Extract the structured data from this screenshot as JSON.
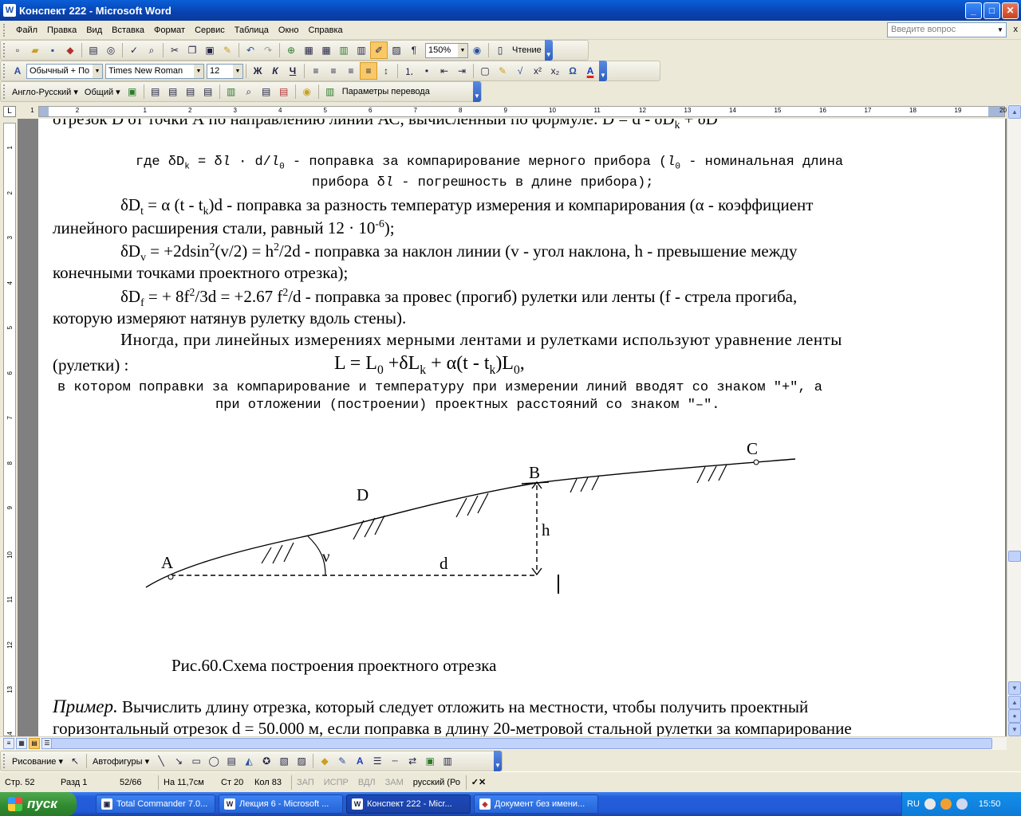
{
  "window": {
    "title": "Конспект  222 - Microsoft Word",
    "app_icon": "W",
    "buttons": [
      "_",
      "□",
      "✕"
    ]
  },
  "menu": {
    "items": [
      "Файл",
      "Правка",
      "Вид",
      "Вставка",
      "Формат",
      "Сервис",
      "Таблица",
      "Окно",
      "Справка"
    ],
    "help_placeholder": "Введите вопрос",
    "close": "x"
  },
  "toolbar_standard": {
    "zoom": "150%",
    "reading": "Чтение"
  },
  "toolbar_format": {
    "style": "Обычный + По ц",
    "font": "Times New Roman",
    "size": "12",
    "bold": "Ж",
    "italic": "К",
    "underline": "Ч",
    "omega": "Ω"
  },
  "toolbar_translate": {
    "lang": "Англо-Русский",
    "dict": "Общий",
    "params": "Параметры перевода"
  },
  "ruler": {
    "h_numbers": [
      "1",
      "2",
      "1",
      "2",
      "3",
      "4",
      "5",
      "6",
      "7",
      "8",
      "9",
      "10",
      "11",
      "12",
      "13",
      "14",
      "15",
      "16",
      "17",
      "18",
      "19",
      "20"
    ],
    "v_numbers": [
      "1",
      "2",
      "3",
      "4",
      "5",
      "6",
      "7",
      "8",
      "9",
      "10",
      "11",
      "12",
      "13",
      "14",
      "15"
    ]
  },
  "document": {
    "line0": "отрезок D от точки А по направлению линии АС, вычисленный по формуле:  D = d - δD",
    "line0_sub": "k",
    "line0_tail": " + δD",
    "mono1": "где δD",
    "mono1_sub": "k",
    "mono1_mid": " = δ",
    "mono1_l": "l",
    "mono1_rest": " · d/",
    "mono1_l2": "l",
    "mono1_sub0": "0",
    "mono1_tail": " - поправка за компарирование мерного прибора (",
    "mono1_l3": "l",
    "mono1_sub0b": "0",
    "mono1_tail2": " - номинальная длина",
    "mono2_pre": "прибора δ",
    "mono2_l": "l",
    "mono2_tail": " - погрешность в длине прибора);",
    "p_t_a": "δD",
    "p_t_sub": "t",
    "p_t_b": " =  α (t - t",
    "p_t_sub2": "k",
    "p_t_c": ")d - поправка за разность температур измерения и компарирования (α -  коэффициент",
    "p_t2": "линейного  расширения  стали, равный 12 · 10",
    "p_t2_sup": "-6",
    "p_t2_tail": ");",
    "p_v_a": "δD",
    "p_v_sub": "v",
    "p_v_b": " = +2dsin",
    "p_v_sup": "2",
    "p_v_c": "(v/2)  =  h",
    "p_v_sup2": "2",
    "p_v_d": "/2d - поправка за наклон линии (v - угол наклона, h - превышение между",
    "p_v2": "конечными точками проектного отрезка);",
    "p_f_a": "δD",
    "p_f_sub": "f",
    "p_f_b": " = + 8f",
    "p_f_sup": "2",
    "p_f_c": "/3d = +2.67  f",
    "p_f_sup2": "2",
    "p_f_d": "/d - поправка за провес (прогиб) рулетки или ленты (f - стрела прогиба,",
    "p_f2": "которую измеряют натянув рулетку вдоль стены).",
    "p_i1": "Иногда, при линейных измерениях мерными лентами и рулетками используют уравнение ленты",
    "p_i2": "(рулетки) :",
    "formula_a": "L = L",
    "formula_sub0": "0",
    "formula_b": " +δL",
    "formula_subk": "k",
    "formula_c": " + α(t - t",
    "formula_subk2": "k",
    "formula_d": ")L",
    "formula_sub0b": "0",
    "formula_e": ",",
    "mono3": "в котором  поправки за компарирование и температуру при измерении линий вводят со знаком \"+\", а",
    "mono4": "при отложении (построении) проектных расстояний со знаком \"–\".",
    "fig_labels": {
      "A": "A",
      "B": "B",
      "C": "C",
      "D": "D",
      "h": "h",
      "d": "d",
      "nu": "ν"
    },
    "caption": "Рис.60.Схема построения проектного отрезка",
    "example_lead": "Пример.",
    "example_text": " Вычислить длину отрезка, который следует отложить на местности, чтобы получить проектный",
    "example_text2": "горизонтальный отрезок d = 50.000 м, если поправка в длину 20-метровой стальной рулетки за компарирование"
  },
  "drawing_toolbar": {
    "draw": "Рисование",
    "autoshapes": "Автофигуры"
  },
  "status": {
    "page": "Стр. 52",
    "section": "Разд 1",
    "pages": "52/66",
    "at": "На 11,7см",
    "line": "Ст 20",
    "col": "Кол 83",
    "rec": "ЗАП",
    "trk": "ИСПР",
    "ext": "ВДЛ",
    "ovr": "ЗАМ",
    "lang": "русский (Ро"
  },
  "taskbar": {
    "start": "пуск",
    "tasks": [
      "Total Commander 7.0...",
      "Лекция 6 - Microsoft ...",
      "Конспект  222 - Micr...",
      "Документ без имени..."
    ],
    "lang": "RU",
    "clock": "15:50"
  }
}
